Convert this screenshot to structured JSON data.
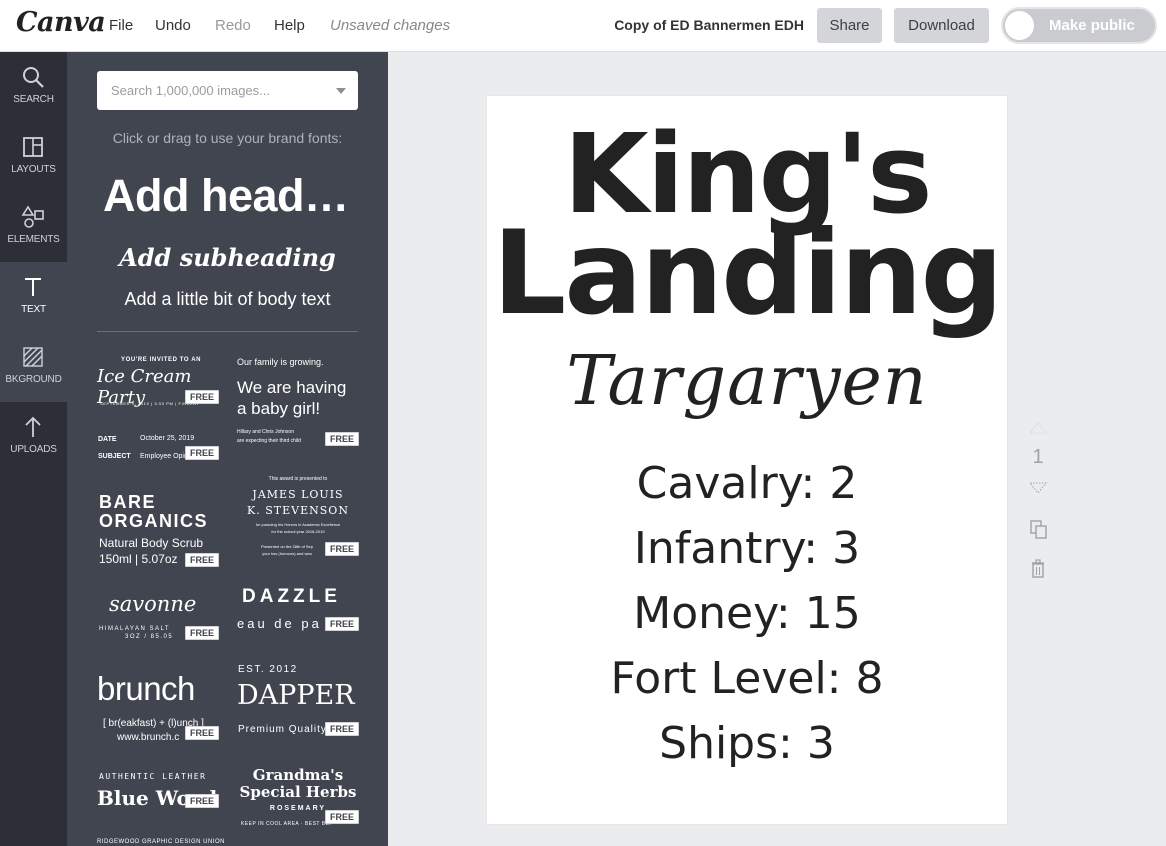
{
  "topbar": {
    "logo": "Canva",
    "menu": [
      "File",
      "Undo",
      "Redo",
      "Help"
    ],
    "status": "Unsaved changes",
    "doc_title": "Copy of ED Bannermen EDH",
    "share": "Share",
    "download": "Download",
    "make_public": "Make public"
  },
  "rail": [
    "SEARCH",
    "LAYOUTS",
    "ELEMENTS",
    "TEXT",
    "BKGROUND",
    "UPLOADS"
  ],
  "panel": {
    "search_placeholder": "Search 1,000,000 images...",
    "brand_note": "Click or drag to use your brand fonts:",
    "add_heading": "Add heading",
    "add_subheading": "Add subheading",
    "add_body": "Add a little bit of body text",
    "free": "FREE",
    "templates": {
      "icecream": {
        "invite": "YOU'RE INVITED TO AN",
        "title": "Ice Cream Party",
        "date": "SEPTEMBER 9, 2019 | 3:00 PM | FINDLAY"
      },
      "baby": {
        "line1": "Our family is growing.",
        "title1": "We are having",
        "title2": "a baby girl!",
        "names1": "Hillary and Chris Johnson",
        "names2": "are expecting their third child"
      },
      "memo": {
        "date_label": "DATE",
        "date_value": "October 25, 2019",
        "subject_label": "SUBJECT",
        "subject_value": "Employee Opin"
      },
      "bare": {
        "title1": "BARE",
        "title2": "ORGANICS",
        "line1": "Natural Body Scrub",
        "line2": "150ml | 5.07oz"
      },
      "james": {
        "pre": "This award is presented to",
        "name1": "JAMES LOUIS",
        "name2": "K. STEVENSON",
        "desc1": "for pursuing his Honors in Academic Excellence",
        "desc2": "for the school year 2018-2019",
        "desc3": "Presented on the 28th of Sep",
        "desc4": "your two (honours) and wea"
      },
      "savonne": {
        "title": "savonne",
        "line1": "HIMALAYAN SALT",
        "line2": "3OZ / 85.05"
      },
      "dazzle": {
        "title": "DAZZLE",
        "sub": "eau de pa"
      },
      "brunch": {
        "title": "brunch",
        "line1": "[ br(eakfast) + (l)unch ]",
        "line2": "www.brunch.c"
      },
      "dapper": {
        "est": "EST. 2012",
        "title": "DAPPER",
        "sub": "Premium Quality"
      },
      "bluewood": {
        "pre": "AUTHENTIC LEATHER",
        "title": "Blue Wood",
        "post": "RIDGEWOOD GRAPHIC DESIGN UNION"
      },
      "grandma": {
        "title1": "Grandma's",
        "title2": "Special Herbs",
        "sub": "ROSEMARY",
        "foot": "KEEP IN COOL AREA · BEST BEF"
      }
    }
  },
  "design": {
    "title_line1": "King's",
    "title_line2": "Landing",
    "house": "Targaryen",
    "stats": [
      "Cavalry: 2",
      "Infantry: 3",
      "Money: 15",
      "Fort Level: 8",
      "Ships: 3"
    ]
  },
  "page_tools": {
    "page_number": "1"
  },
  "colors": {
    "panel": "#40454f",
    "rail": "#2c2f36",
    "workspace": "#ebecee"
  }
}
